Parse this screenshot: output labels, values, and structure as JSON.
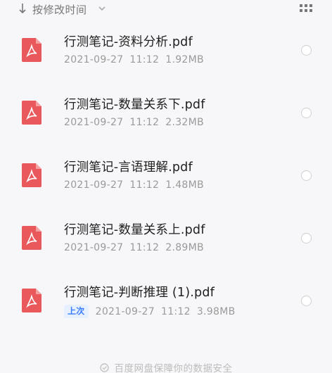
{
  "sort": {
    "label": "按修改时间",
    "arrow_icon": "arrow-down-icon",
    "chevron_icon": "chevron-down-icon"
  },
  "view_toggle_icon": "grid-icon",
  "files": [
    {
      "name": "行测笔记-资料分析.pdf",
      "date": "2021-09-27",
      "time": "11:12",
      "size": "1.92MB",
      "badge": ""
    },
    {
      "name": "行测笔记-数量关系下.pdf",
      "date": "2021-09-27",
      "time": "11:12",
      "size": "2.32MB",
      "badge": ""
    },
    {
      "name": "行测笔记-言语理解.pdf",
      "date": "2021-09-27",
      "time": "11:12",
      "size": "1.48MB",
      "badge": ""
    },
    {
      "name": "行测笔记-数量关系上.pdf",
      "date": "2021-09-27",
      "time": "11:12",
      "size": "2.89MB",
      "badge": ""
    },
    {
      "name": "行测笔记-判断推理 (1).pdf",
      "date": "2021-09-27",
      "time": "11:12",
      "size": "3.98MB",
      "badge": "上次"
    }
  ],
  "footer": {
    "text": "百度网盘保障你的数据安全",
    "icon": "shield-icon"
  },
  "colors": {
    "pdf_red": "#e9585a",
    "badge_blue": "#3b7cff",
    "background": "#f7f7f9"
  }
}
